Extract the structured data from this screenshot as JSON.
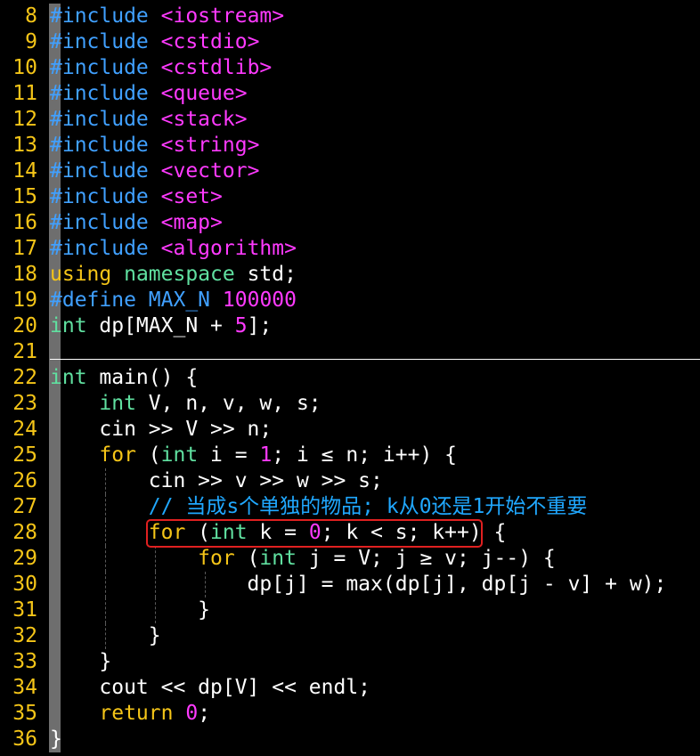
{
  "editor": {
    "colors": {
      "background": "#000000",
      "line_number": "#f5c518",
      "preprocessor": "#40a0ff",
      "header": "#ff3aff",
      "keyword": "#f5c518",
      "type": "#60e0a0",
      "plain": "#ffffff",
      "number": "#ff3aff",
      "comment": "#20a8ff",
      "highlight_box": "#e02020"
    },
    "lines": [
      {
        "num": "8",
        "guides": 0,
        "tokens": [
          {
            "t": "#include",
            "c": "pre"
          },
          {
            "t": " ",
            "c": "plain"
          },
          {
            "t": "<iostream>",
            "c": "hdr"
          }
        ]
      },
      {
        "num": "9",
        "guides": 0,
        "tokens": [
          {
            "t": "#include",
            "c": "pre"
          },
          {
            "t": " ",
            "c": "plain"
          },
          {
            "t": "<cstdio>",
            "c": "hdr"
          }
        ]
      },
      {
        "num": "10",
        "guides": 0,
        "tokens": [
          {
            "t": "#include",
            "c": "pre"
          },
          {
            "t": " ",
            "c": "plain"
          },
          {
            "t": "<cstdlib>",
            "c": "hdr"
          }
        ]
      },
      {
        "num": "11",
        "guides": 0,
        "tokens": [
          {
            "t": "#include",
            "c": "pre"
          },
          {
            "t": " ",
            "c": "plain"
          },
          {
            "t": "<queue>",
            "c": "hdr"
          }
        ]
      },
      {
        "num": "12",
        "guides": 0,
        "tokens": [
          {
            "t": "#include",
            "c": "pre"
          },
          {
            "t": " ",
            "c": "plain"
          },
          {
            "t": "<stack>",
            "c": "hdr"
          }
        ]
      },
      {
        "num": "13",
        "guides": 0,
        "tokens": [
          {
            "t": "#include",
            "c": "pre"
          },
          {
            "t": " ",
            "c": "plain"
          },
          {
            "t": "<string>",
            "c": "hdr"
          }
        ]
      },
      {
        "num": "14",
        "guides": 0,
        "tokens": [
          {
            "t": "#include",
            "c": "pre"
          },
          {
            "t": " ",
            "c": "plain"
          },
          {
            "t": "<vector>",
            "c": "hdr"
          }
        ]
      },
      {
        "num": "15",
        "guides": 0,
        "tokens": [
          {
            "t": "#include",
            "c": "pre"
          },
          {
            "t": " ",
            "c": "plain"
          },
          {
            "t": "<set>",
            "c": "hdr"
          }
        ]
      },
      {
        "num": "16",
        "guides": 0,
        "tokens": [
          {
            "t": "#include",
            "c": "pre"
          },
          {
            "t": " ",
            "c": "plain"
          },
          {
            "t": "<map>",
            "c": "hdr"
          }
        ]
      },
      {
        "num": "17",
        "guides": 0,
        "tokens": [
          {
            "t": "#include",
            "c": "pre"
          },
          {
            "t": " ",
            "c": "plain"
          },
          {
            "t": "<algorithm>",
            "c": "hdr"
          }
        ]
      },
      {
        "num": "18",
        "guides": 0,
        "tokens": [
          {
            "t": "using",
            "c": "kw"
          },
          {
            "t": " ",
            "c": "plain"
          },
          {
            "t": "namespace",
            "c": "type"
          },
          {
            "t": " std;",
            "c": "plain"
          }
        ]
      },
      {
        "num": "19",
        "guides": 0,
        "tokens": [
          {
            "t": "#define",
            "c": "pre"
          },
          {
            "t": " ",
            "c": "plain"
          },
          {
            "t": "MAX_N",
            "c": "pre"
          },
          {
            "t": " ",
            "c": "plain"
          },
          {
            "t": "100000",
            "c": "num"
          }
        ]
      },
      {
        "num": "20",
        "guides": 0,
        "tokens": [
          {
            "t": "int",
            "c": "type"
          },
          {
            "t": " dp[MAX_N + ",
            "c": "plain"
          },
          {
            "t": "5",
            "c": "num"
          },
          {
            "t": "];",
            "c": "plain"
          }
        ]
      },
      {
        "num": "21",
        "guides": 0,
        "tokens": []
      },
      {
        "num": "22",
        "guides": 0,
        "tokens": [
          {
            "t": "int",
            "c": "type"
          },
          {
            "t": " main() {",
            "c": "plain"
          }
        ]
      },
      {
        "num": "23",
        "guides": 0,
        "tokens": [
          {
            "t": "    ",
            "c": "plain"
          },
          {
            "t": "int",
            "c": "type"
          },
          {
            "t": " V, n, v, w, s;",
            "c": "plain"
          }
        ]
      },
      {
        "num": "24",
        "guides": 0,
        "tokens": [
          {
            "t": "    cin >> V >> n;",
            "c": "plain"
          }
        ]
      },
      {
        "num": "25",
        "guides": 0,
        "tokens": [
          {
            "t": "    ",
            "c": "plain"
          },
          {
            "t": "for",
            "c": "kw"
          },
          {
            "t": " (",
            "c": "plain"
          },
          {
            "t": "int",
            "c": "type"
          },
          {
            "t": " i = ",
            "c": "plain"
          },
          {
            "t": "1",
            "c": "num"
          },
          {
            "t": "; i ≤ n; i++) {",
            "c": "plain"
          }
        ]
      },
      {
        "num": "26",
        "guides": 1,
        "tokens": [
          {
            "t": "        cin >> v >> w >> s;",
            "c": "plain"
          }
        ]
      },
      {
        "num": "27",
        "guides": 1,
        "tokens": [
          {
            "t": "        ",
            "c": "plain"
          },
          {
            "t": "// 当成s个单独的物品; k从0还是1开始不重要",
            "c": "cmt"
          }
        ]
      },
      {
        "num": "28",
        "guides": 1,
        "tokens": [
          {
            "t": "        ",
            "c": "plain"
          },
          {
            "t": "for",
            "c": "kw"
          },
          {
            "t": " (",
            "c": "plain"
          },
          {
            "t": "int",
            "c": "type"
          },
          {
            "t": " k = ",
            "c": "plain"
          },
          {
            "t": "0",
            "c": "num"
          },
          {
            "t": "; k < s; k++) {",
            "c": "plain"
          }
        ]
      },
      {
        "num": "29",
        "guides": 2,
        "tokens": [
          {
            "t": "            ",
            "c": "plain"
          },
          {
            "t": "for",
            "c": "kw"
          },
          {
            "t": " (",
            "c": "plain"
          },
          {
            "t": "int",
            "c": "type"
          },
          {
            "t": " j = V; j ≥ v; j--) {",
            "c": "plain"
          }
        ]
      },
      {
        "num": "30",
        "guides": 3,
        "tokens": [
          {
            "t": "                dp[j] = max(dp[j], dp[j - v] + w);",
            "c": "plain"
          }
        ]
      },
      {
        "num": "31",
        "guides": 2,
        "tokens": [
          {
            "t": "            }",
            "c": "plain"
          }
        ]
      },
      {
        "num": "32",
        "guides": 1,
        "tokens": [
          {
            "t": "        }",
            "c": "plain"
          }
        ]
      },
      {
        "num": "33",
        "guides": 0,
        "tokens": [
          {
            "t": "    }",
            "c": "plain"
          }
        ]
      },
      {
        "num": "34",
        "guides": 0,
        "tokens": [
          {
            "t": "    cout << dp[V] << endl;",
            "c": "plain"
          }
        ]
      },
      {
        "num": "35",
        "guides": 0,
        "tokens": [
          {
            "t": "    ",
            "c": "plain"
          },
          {
            "t": "return",
            "c": "kw"
          },
          {
            "t": " ",
            "c": "plain"
          },
          {
            "t": "0",
            "c": "num"
          },
          {
            "t": ";",
            "c": "plain"
          }
        ]
      },
      {
        "num": "36",
        "guides": 0,
        "tokens": [
          {
            "t": "}",
            "c": "plain"
          }
        ]
      }
    ]
  }
}
